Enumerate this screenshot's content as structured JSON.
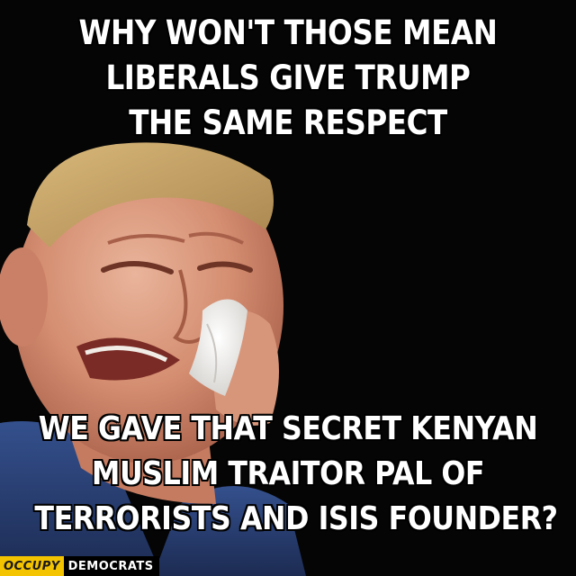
{
  "meme": {
    "top_caption": [
      "WHY WON'T THOSE MEAN",
      "LIBERALS GIVE TRUMP",
      "THE SAME RESPECT"
    ],
    "bottom_caption": [
      "WE GAVE THAT SECRET KENYAN",
      "MUSLIM TRAITOR PAL OF",
      "TERRORISTS AND ISIS FOUNDER?"
    ]
  },
  "brand": {
    "occupy": "OCCUPY",
    "democrats": "DEMOCRATS"
  },
  "colors": {
    "background": "#000000",
    "caption_text": "#ffffff",
    "brand_yellow": "#f5c400",
    "shirt_blue": "#2a3f73"
  }
}
